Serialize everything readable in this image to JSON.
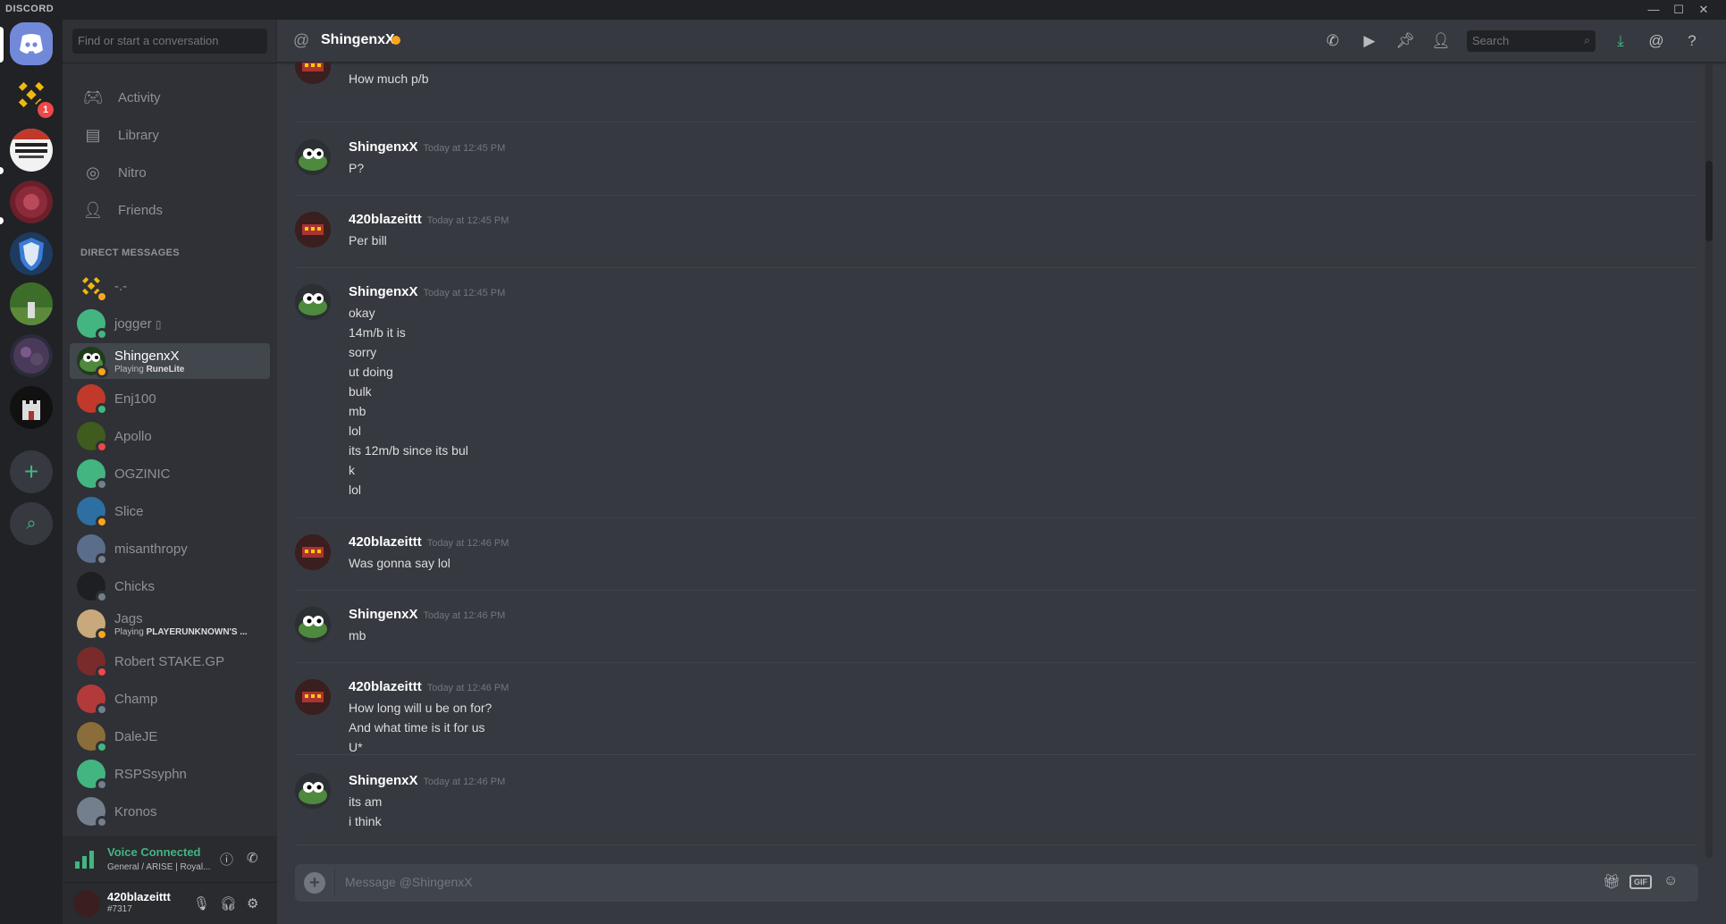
{
  "app": {
    "brand": "DISCORD"
  },
  "window_controls": [
    "—",
    "☐",
    "✕"
  ],
  "servers": {
    "binance_badge": "1"
  },
  "sidebar": {
    "search_placeholder": "Find or start a conversation",
    "nav": [
      {
        "label": "Activity",
        "icon": "gamepad-icon"
      },
      {
        "label": "Library",
        "icon": "library-icon"
      },
      {
        "label": "Nitro",
        "icon": "nitro-icon"
      },
      {
        "label": "Friends",
        "icon": "friends-icon"
      }
    ],
    "dm_header": "DIRECT MESSAGES",
    "dms": [
      {
        "name": "-.-",
        "status": "idle",
        "avatar_color": "#f0b90b"
      },
      {
        "name": "jogger",
        "status": "online",
        "avatar_color": "#43b581",
        "mobile": "▯"
      },
      {
        "name": "ShingenxX",
        "status": "idle",
        "avatar_color": "#4e8a3e",
        "sub_prefix": "Playing ",
        "sub_game": "RuneLite",
        "active": true
      },
      {
        "name": "Enj100",
        "status": "online",
        "avatar_color": "#c0392b"
      },
      {
        "name": "Apollo",
        "status": "dnd",
        "avatar_color": "#3f5b1e"
      },
      {
        "name": "OGZINIC",
        "status": "offline",
        "avatar_color": "#43b581"
      },
      {
        "name": "Slice",
        "status": "idle",
        "avatar_color": "#2d6fa3"
      },
      {
        "name": "misanthropy",
        "status": "offline",
        "avatar_color": "#5a6d8a"
      },
      {
        "name": "Chicks",
        "status": "offline",
        "avatar_color": "#1e1f22"
      },
      {
        "name": "Jags",
        "status": "idle",
        "avatar_color": "#c9a87c",
        "sub_prefix": "Playing ",
        "sub_game": "PLAYERUNKNOWN'S ..."
      },
      {
        "name": "Robert STAKE.GP",
        "status": "dnd",
        "avatar_color": "#7a2a2a"
      },
      {
        "name": "Champ",
        "status": "offline",
        "avatar_color": "#b33a3a"
      },
      {
        "name": "DaleJE",
        "status": "online",
        "avatar_color": "#8a6d3b"
      },
      {
        "name": "RSPSsyphn",
        "status": "offline",
        "avatar_color": "#43b581"
      },
      {
        "name": "Kronos",
        "status": "offline",
        "avatar_color": "#747f8d"
      }
    ],
    "voice": {
      "title": "Voice Connected",
      "subtitle": "General / ARISE | Royal..."
    },
    "user": {
      "name": "420blazeittt",
      "tag": "#7317"
    }
  },
  "chat": {
    "header": {
      "title": "ShingenxX",
      "search_placeholder": "Search"
    },
    "composer_placeholder": "Message @ShingenxX",
    "groups": [
      {
        "author": "",
        "time": "",
        "avatar": "blaze",
        "lines": [
          "How much p/b"
        ]
      },
      {
        "author": "ShingenxX",
        "time": "Today at 12:45 PM",
        "avatar": "frog",
        "lines": [
          "P?"
        ]
      },
      {
        "author": "420blazeittt",
        "time": "Today at 12:45 PM",
        "avatar": "blaze",
        "lines": [
          "Per bill"
        ]
      },
      {
        "author": "ShingenxX",
        "time": "Today at 12:45 PM",
        "avatar": "frog",
        "lines": [
          "okay",
          "14m/b it is",
          "sorry",
          "ut doing",
          "bulk",
          "mb",
          "lol",
          "its 12m/b since its bul",
          "k",
          "lol"
        ]
      },
      {
        "author": "420blazeittt",
        "time": "Today at 12:46 PM",
        "avatar": "blaze",
        "lines": [
          "Was gonna say lol"
        ]
      },
      {
        "author": "ShingenxX",
        "time": "Today at 12:46 PM",
        "avatar": "frog",
        "lines": [
          "mb"
        ]
      },
      {
        "author": "420blazeittt",
        "time": "Today at 12:46 PM",
        "avatar": "blaze",
        "lines": [
          "How long will u be on for?",
          "And what time is it for us",
          "U*"
        ]
      },
      {
        "author": "ShingenxX",
        "time": "Today at 12:46 PM",
        "avatar": "frog",
        "lines": [
          "its am",
          "i think"
        ]
      }
    ]
  },
  "colors": {
    "online": "#43b581",
    "idle": "#faa61a",
    "dnd": "#f04747",
    "offline": "#747f8d",
    "accent": "#7289da"
  }
}
